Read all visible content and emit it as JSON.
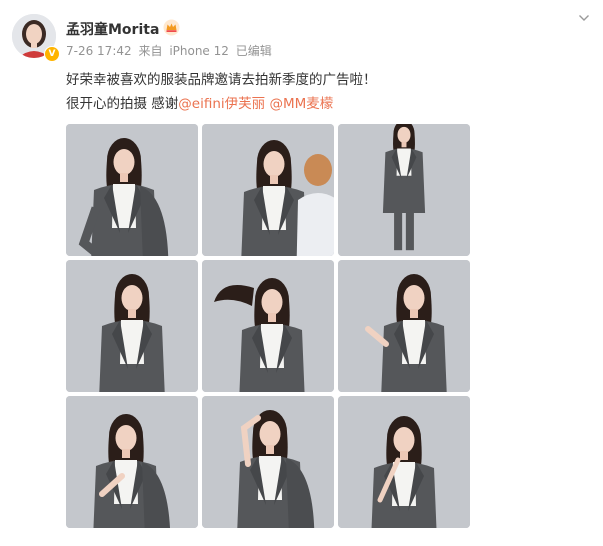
{
  "post": {
    "username": "孟羽童Morita",
    "date": "7-26 17:42",
    "source_prefix": "来自",
    "device": "iPhone 12",
    "edited": "已编辑",
    "text_line1": "好荣幸被喜欢的服装品牌邀请去拍新季度的广告啦！",
    "text_line2_prefix": "很开心的拍摄 感谢",
    "mention1": "@eifini伊芙丽",
    "mention2": "@MM麦檬"
  },
  "icons": {
    "verified": "verified-badge-icon",
    "crown": "vip-crown-icon",
    "more": "chevron-down-icon"
  },
  "colors": {
    "mention": "#eb7350",
    "meta": "#939393",
    "verified": "#ffb400",
    "suit": "#55575a",
    "background": "#c4c7cc"
  },
  "photos": [
    {
      "pose": "hand-on-hip",
      "suit": "jacket-over-shoulder"
    },
    {
      "pose": "with-stylist",
      "suit": "full-suit"
    },
    {
      "pose": "full-body",
      "suit": "full-suit"
    },
    {
      "pose": "standing",
      "suit": "full-suit"
    },
    {
      "pose": "hair-flip",
      "suit": "full-suit"
    },
    {
      "pose": "hand-raised",
      "suit": "full-suit"
    },
    {
      "pose": "hand-on-chest",
      "suit": "jacket-over-shoulder"
    },
    {
      "pose": "hand-on-head",
      "suit": "jacket-over-shoulder"
    },
    {
      "pose": "hand-at-neck",
      "suit": "full-suit"
    }
  ]
}
